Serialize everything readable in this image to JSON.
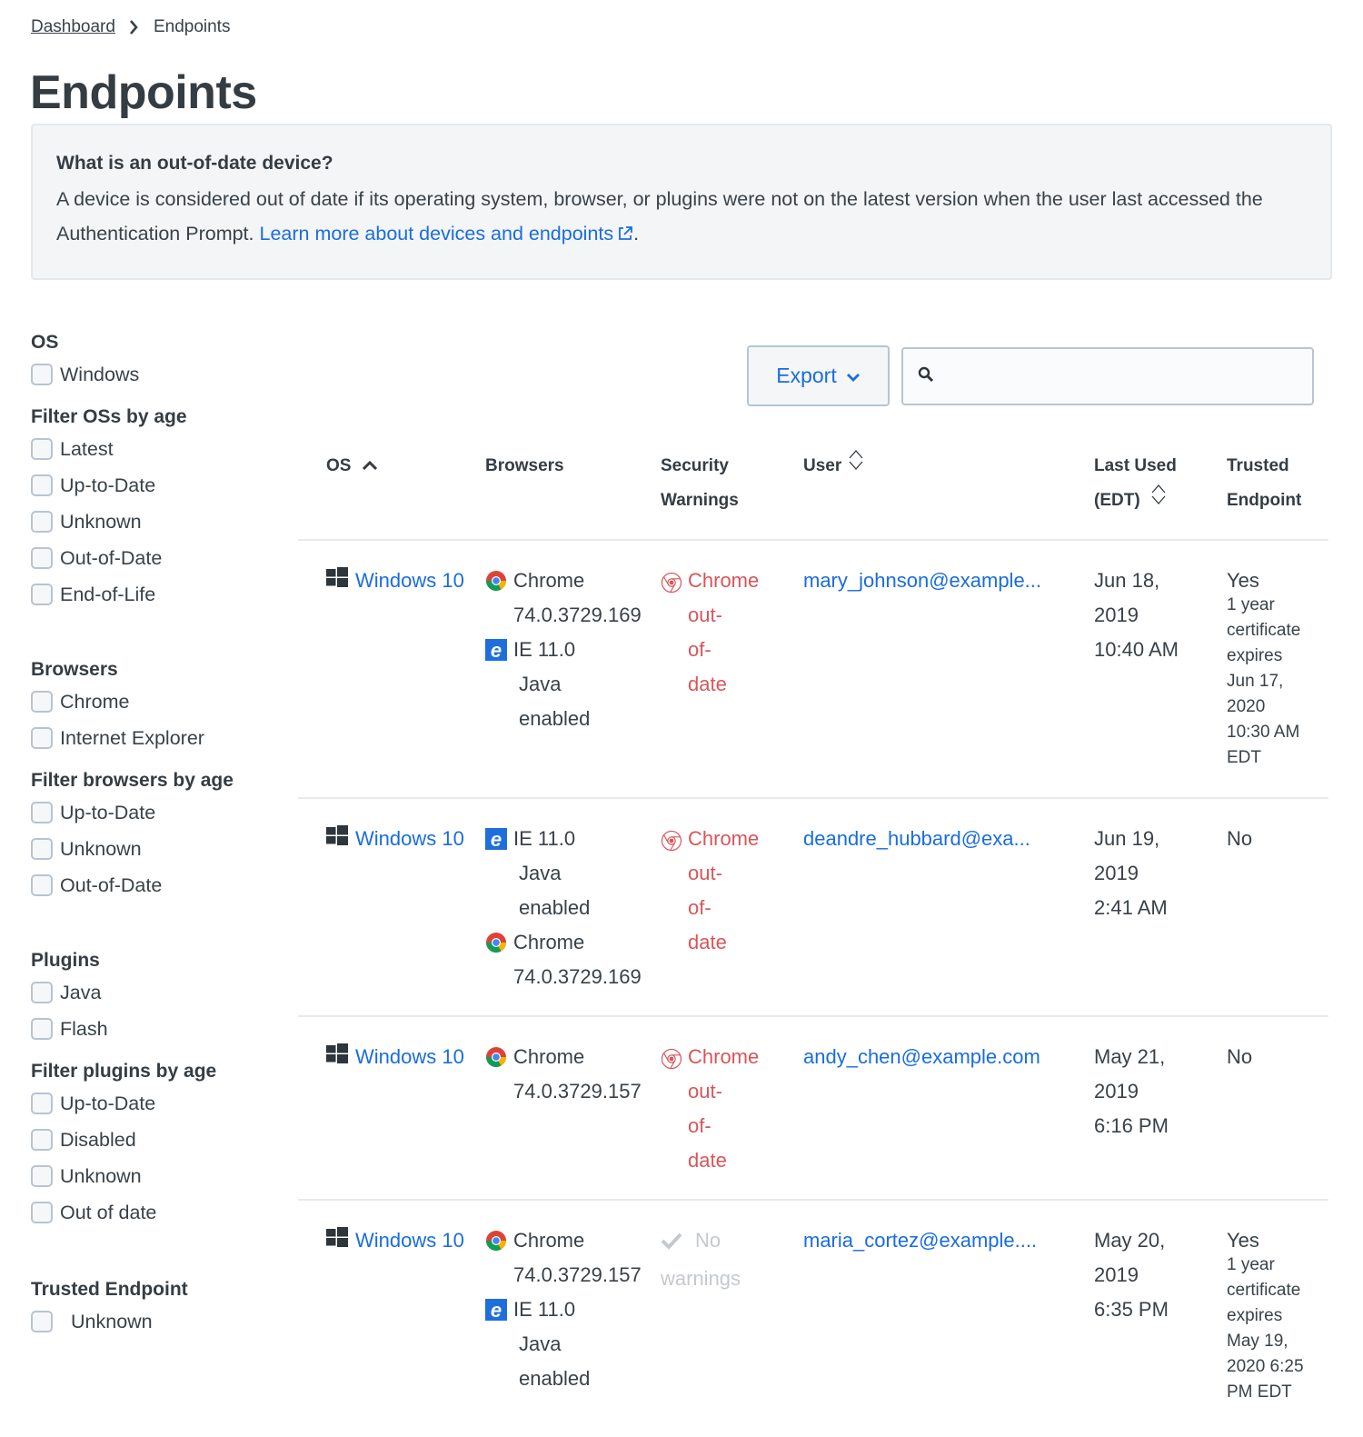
{
  "breadcrumb": {
    "parent": "Dashboard",
    "current": "Endpoints"
  },
  "page_title": "Endpoints",
  "info": {
    "heading": "What is an out-of-date device?",
    "body": "A device is considered out of date if its operating system, browser, or plugins were not on the latest version when the user last accessed the Authentication Prompt. ",
    "link": "Learn more about devices and endpoints",
    "trailing": "."
  },
  "toolbar": {
    "export_label": "Export",
    "search_placeholder": "",
    "search_value": ""
  },
  "filters": {
    "os": {
      "title": "OS",
      "items": [
        "Windows"
      ]
    },
    "os_age": {
      "title": "Filter OSs by age",
      "items": [
        "Latest",
        "Up-to-Date",
        "Unknown",
        "Out-of-Date",
        "End-of-Life"
      ]
    },
    "browsers": {
      "title": "Browsers",
      "items": [
        "Chrome",
        "Internet Explorer"
      ]
    },
    "browser_age": {
      "title": "Filter browsers by age",
      "items": [
        "Up-to-Date",
        "Unknown",
        "Out-of-Date"
      ]
    },
    "plugins": {
      "title": "Plugins",
      "items": [
        "Java",
        "Flash"
      ]
    },
    "plugin_age": {
      "title": "Filter plugins by age",
      "items": [
        "Up-to-Date",
        "Disabled",
        "Unknown",
        "Out of date"
      ]
    },
    "trusted": {
      "title": "Trusted Endpoint",
      "items": [
        "Unknown"
      ]
    }
  },
  "table": {
    "headers": {
      "os": "OS",
      "browsers": "Browsers",
      "security_1": "Security",
      "security_2": "Warnings",
      "user": "User",
      "last_used_1": "Last Used",
      "last_used_2": "(EDT)",
      "trusted_1": "Trusted",
      "trusted_2": "Endpoint"
    },
    "rows": [
      {
        "os": "Windows 10",
        "browsers": [
          {
            "icon": "chrome",
            "name": "Chrome",
            "version": "74.0.3729.169"
          },
          {
            "icon": "ie",
            "name": "IE 11.0",
            "plugin_1": "Java",
            "plugin_2": "enabled"
          }
        ],
        "security": {
          "status": "warning",
          "lines": [
            "Chrome",
            "out-",
            "of-",
            "date"
          ]
        },
        "user": "mary_johnson@example...",
        "last_used": [
          "Jun 18,",
          "2019",
          "10:40 AM"
        ],
        "trusted": "Yes",
        "trusted_detail": [
          "1 year",
          "certificate",
          "expires",
          "Jun 17,",
          "2020",
          "10:30 AM",
          "EDT"
        ]
      },
      {
        "os": "Windows 10",
        "browsers": [
          {
            "icon": "ie",
            "name": "IE 11.0",
            "plugin_1": "Java",
            "plugin_2": "enabled"
          },
          {
            "icon": "chrome",
            "name": "Chrome",
            "version": "74.0.3729.169"
          }
        ],
        "security": {
          "status": "warning",
          "lines": [
            "Chrome",
            "out-",
            "of-",
            "date"
          ]
        },
        "user": "deandre_hubbard@exa...",
        "last_used": [
          "Jun 19,",
          "2019",
          "2:41 AM"
        ],
        "trusted": "No",
        "trusted_detail": []
      },
      {
        "os": "Windows 10",
        "browsers": [
          {
            "icon": "chrome",
            "name": "Chrome",
            "version": "74.0.3729.157"
          }
        ],
        "security": {
          "status": "warning",
          "lines": [
            "Chrome",
            "out-",
            "of-",
            "date"
          ]
        },
        "user": "andy_chen@example.com",
        "last_used": [
          "May 21,",
          "2019",
          "6:16 PM"
        ],
        "trusted": "No",
        "trusted_detail": []
      },
      {
        "os": "Windows 10",
        "browsers": [
          {
            "icon": "chrome",
            "name": "Chrome",
            "version": "74.0.3729.157"
          },
          {
            "icon": "ie",
            "name": "IE 11.0",
            "plugin_1": "Java",
            "plugin_2": "enabled"
          }
        ],
        "security": {
          "status": "ok",
          "lines": [
            "No",
            "warnings"
          ]
        },
        "user": "maria_cortez@example....",
        "last_used": [
          "May 20,",
          "2019",
          "6:35 PM"
        ],
        "trusted": "Yes",
        "trusted_detail": [
          "1 year",
          "certificate",
          "expires",
          "May 19,",
          "2020 6:25",
          "PM EDT"
        ]
      }
    ]
  },
  "colors": {
    "link": "#1a6de0",
    "warning": "#d9555a",
    "muted": "#c5c9cd",
    "text": "#394248"
  }
}
